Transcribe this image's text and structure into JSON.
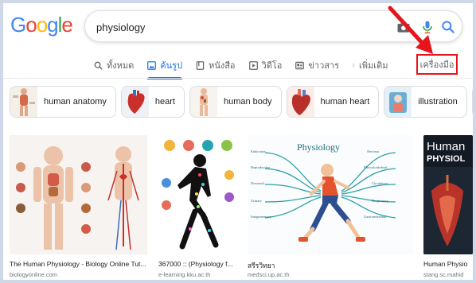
{
  "logo": {
    "letters": [
      "G",
      "o",
      "o",
      "g",
      "l",
      "e"
    ],
    "colors": [
      "#4285F4",
      "#EA4335",
      "#FBBC05",
      "#4285F4",
      "#34A853",
      "#EA4335"
    ]
  },
  "search": {
    "query": "physiology",
    "icons": [
      "camera-icon",
      "mic-icon",
      "search-icon"
    ]
  },
  "tabs": [
    {
      "label": "ทั้งหมด",
      "icon": "search-icon",
      "active": false
    },
    {
      "label": "ค้นรูป",
      "icon": "image-icon",
      "active": true
    },
    {
      "label": "หนังสือ",
      "icon": "book-icon",
      "active": false
    },
    {
      "label": "วิดีโอ",
      "icon": "video-icon",
      "active": false
    },
    {
      "label": "ข่าวสาร",
      "icon": "news-icon",
      "active": false
    },
    {
      "label": "เพิ่มเติม",
      "icon": "more-icon",
      "active": false
    }
  ],
  "tools_label": "เครื่องมือ",
  "annotation": {
    "arrow_color": "#e8141c",
    "box_color": "#e8141c"
  },
  "chips": [
    {
      "label": "human anatomy"
    },
    {
      "label": "heart"
    },
    {
      "label": "human body"
    },
    {
      "label": "human heart"
    },
    {
      "label": "illustration"
    },
    {
      "label": ""
    }
  ],
  "results": [
    {
      "title": "The Human Physiology - Biology Online Tut...",
      "source": "biologyonline.com"
    },
    {
      "title": "367000 :: (Physiology f...",
      "source": "e-learning.kku.ac.th"
    },
    {
      "title": "สรีรวิทยา",
      "source": "medsci.up.ac.th"
    },
    {
      "title": "Human Physio",
      "source": "stang.sc.mahid"
    }
  ],
  "diagram_text": {
    "heading": "Physiology",
    "left": [
      "Endocrine",
      "Reproductive",
      "Neuronal",
      "Urinary",
      "Integumentary"
    ],
    "right": [
      "Nervous",
      "Musculoskeletal",
      "Circulatory",
      "Respiratory",
      "Gastrointestinal"
    ]
  },
  "book_cover": {
    "line1": "Human",
    "line2": "PHYSIOL"
  }
}
